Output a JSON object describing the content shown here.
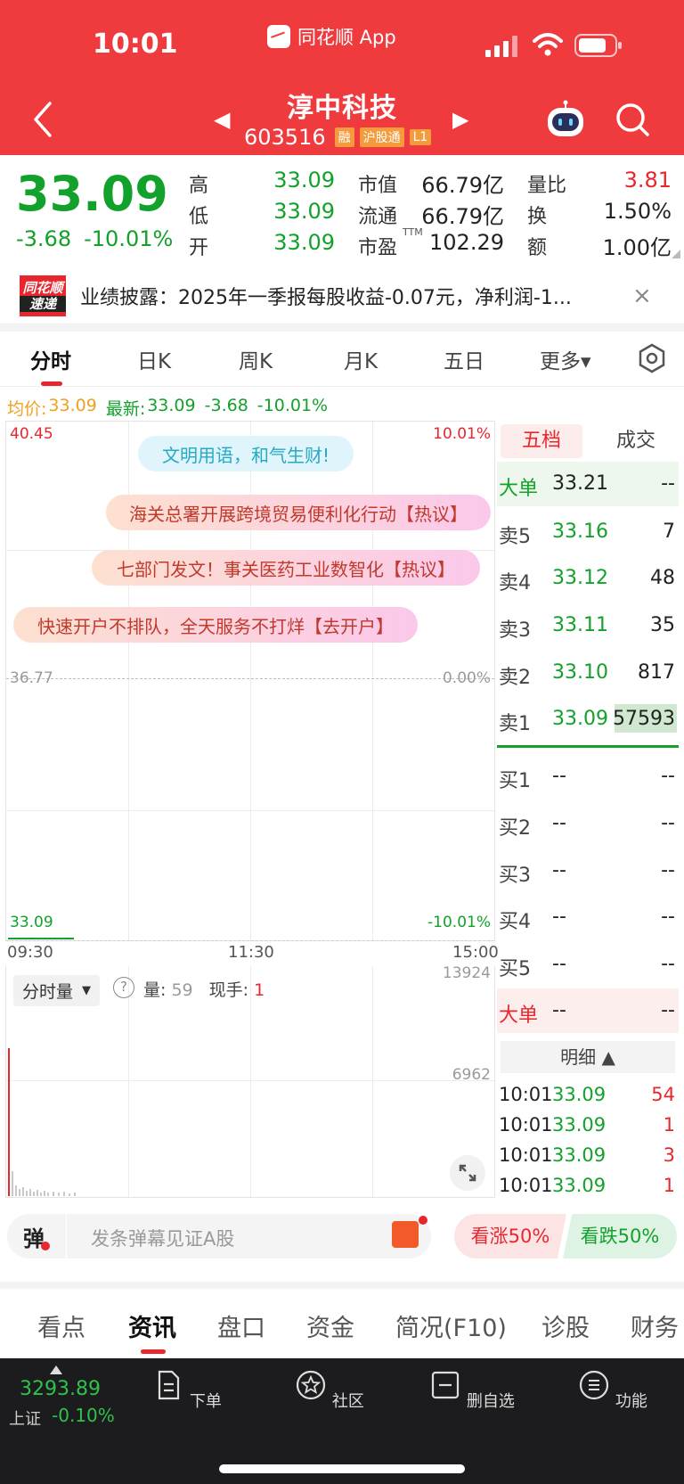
{
  "status_bar": {
    "time": "10:01",
    "app_name": "同花顺 App"
  },
  "header": {
    "stock_name": "淳中科技",
    "stock_code": "603516",
    "tags": [
      "融",
      "沪股通",
      "L1"
    ],
    "prev_arrow": "◀",
    "next_arrow": "▶"
  },
  "quote": {
    "last_price": "33.09",
    "change": "-3.68",
    "change_pct": "-10.01%",
    "high_label": "高",
    "high": "33.09",
    "low_label": "低",
    "low": "33.09",
    "open_label": "开",
    "open": "33.09",
    "mktcap_label": "市值",
    "mktcap": "66.79亿",
    "float_label": "流通",
    "float": "66.79亿",
    "pe_label": "市盈",
    "pe_sup": "TTM",
    "pe": "102.29",
    "vol_ratio_label": "量比",
    "vol_ratio": "3.81",
    "turnover_label": "换",
    "turnover": "1.50%",
    "amount_label": "额",
    "amount": "1.00亿"
  },
  "news": {
    "logo_top": "同花顺",
    "logo_bottom": "速递",
    "text": "业绩披露：2025年一季报每股收益-0.07元，净利润-1...",
    "close": "×"
  },
  "chart_tabs": [
    "分时",
    "日K",
    "周K",
    "月K",
    "五日",
    "更多▾"
  ],
  "avg_row": {
    "avg_label": "均价:",
    "avg": "33.09",
    "latest_label": "最新:",
    "latest": "33.09",
    "change": "-3.68",
    "change_pct": "-10.01%"
  },
  "chart": {
    "y_top": "40.45",
    "y_mid": "36.77",
    "y_bottom": "33.09",
    "pct_top": "10.01%",
    "pct_mid": "0.00%",
    "pct_bottom": "-10.01%",
    "times": [
      "09:30",
      "11:30",
      "15:00"
    ],
    "bubbles": [
      "文明用语，和气生财!",
      "海关总署开展跨境贸易便利化行动【热议】",
      "七部门发文！事关医药工业数智化【热议】",
      "快速开户不排队，全天服务不打烊【去开户】"
    ]
  },
  "volume": {
    "selector": "分时量",
    "selector_arrow": "▼",
    "help": "?",
    "vol_label": "量:",
    "vol": "59",
    "current_label": "现手:",
    "current": "1",
    "max": "13924",
    "mid": "6962"
  },
  "order_book": {
    "tab_five": "五档",
    "tab_trade": "成交",
    "big_sell": {
      "label": "大单",
      "price": "33.21",
      "vol": "--"
    },
    "sells": [
      {
        "label": "卖5",
        "price": "33.16",
        "vol": "7"
      },
      {
        "label": "卖4",
        "price": "33.12",
        "vol": "48"
      },
      {
        "label": "卖3",
        "price": "33.11",
        "vol": "35"
      },
      {
        "label": "卖2",
        "price": "33.10",
        "vol": "817"
      },
      {
        "label": "卖1",
        "price": "33.09",
        "vol": "57593"
      }
    ],
    "buys": [
      {
        "label": "买1",
        "price": "--",
        "vol": "--"
      },
      {
        "label": "买2",
        "price": "--",
        "vol": "--"
      },
      {
        "label": "买3",
        "price": "--",
        "vol": "--"
      },
      {
        "label": "买4",
        "price": "--",
        "vol": "--"
      },
      {
        "label": "买5",
        "price": "--",
        "vol": "--"
      }
    ],
    "big_buy": {
      "label": "大单",
      "price": "--",
      "vol": "--"
    },
    "detail_label": "明细 ▲",
    "details": [
      {
        "time": "10:01",
        "price": "33.09",
        "vol": "54"
      },
      {
        "time": "10:01",
        "price": "33.09",
        "vol": "1"
      },
      {
        "time": "10:01",
        "price": "33.09",
        "vol": "3"
      },
      {
        "time": "10:01",
        "price": "33.09",
        "vol": "1"
      }
    ]
  },
  "comment": {
    "danmu": "弹",
    "placeholder": "发条弹幕见证A股",
    "up_vote": "看涨50%",
    "down_vote": "看跌50%"
  },
  "info_tabs": [
    "看点",
    "资讯",
    "盘口",
    "资金",
    "简况(F10)",
    "诊股",
    "财务"
  ],
  "bottom_nav": {
    "index_value": "3293.89",
    "index_name": "上证",
    "index_change": "-0.10%",
    "items": [
      "下单",
      "社区",
      "删自选",
      "功能"
    ]
  },
  "colors": {
    "brand_red": "#ef3a3e",
    "down_green": "#12a12a",
    "up_red": "#e8262d"
  }
}
